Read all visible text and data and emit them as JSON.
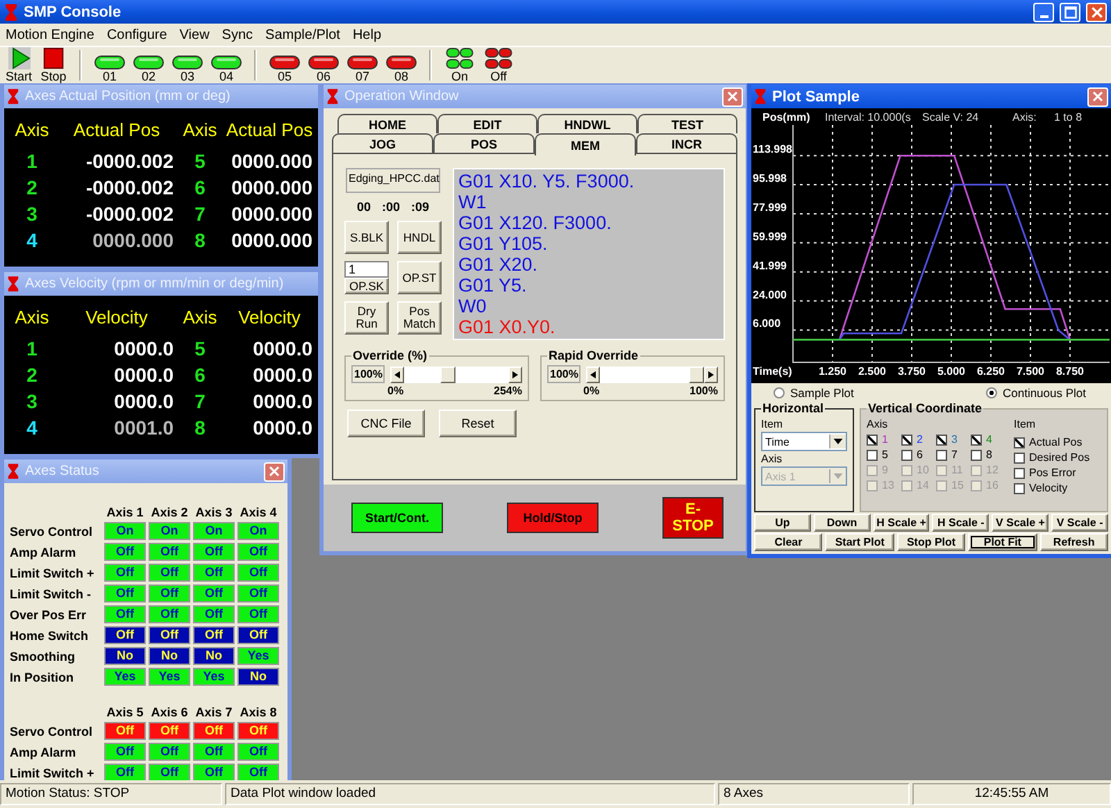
{
  "window": {
    "title": "SMP Console"
  },
  "menu": [
    "Motion Engine",
    "Configure",
    "View",
    "Sync",
    "Sample/Plot",
    "Help"
  ],
  "toolbar": [
    {
      "kind": "start",
      "label": "Start"
    },
    {
      "kind": "stop",
      "label": "Stop"
    },
    {
      "kind": "separator"
    },
    {
      "kind": "led_green",
      "label": "01"
    },
    {
      "kind": "led_green",
      "label": "02"
    },
    {
      "kind": "led_green",
      "label": "03"
    },
    {
      "kind": "led_green",
      "label": "04"
    },
    {
      "kind": "separator"
    },
    {
      "kind": "led_red",
      "label": "05"
    },
    {
      "kind": "led_red",
      "label": "06"
    },
    {
      "kind": "led_red",
      "label": "07"
    },
    {
      "kind": "led_red",
      "label": "08"
    },
    {
      "kind": "separator"
    },
    {
      "kind": "all_on",
      "label": "On"
    },
    {
      "kind": "all_off",
      "label": "Off"
    }
  ],
  "position": {
    "title": "Axes Actual Position (mm or deg)",
    "headers": [
      "Axis",
      "Actual Pos",
      "Axis",
      "Actual Pos"
    ],
    "axes": [
      {
        "label": "1",
        "value": "-0000.002",
        "selected": false
      },
      {
        "label": "2",
        "value": "-0000.002",
        "selected": false
      },
      {
        "label": "3",
        "value": "-0000.002",
        "selected": false
      },
      {
        "label": "4",
        "value": "0000.000",
        "selected": true
      },
      {
        "label": "5",
        "value": "0000.000",
        "selected": false
      },
      {
        "label": "6",
        "value": "0000.000",
        "selected": false
      },
      {
        "label": "7",
        "value": "0000.000",
        "selected": false
      },
      {
        "label": "8",
        "value": "0000.000",
        "selected": false
      }
    ]
  },
  "velocity": {
    "title": "Axes Velocity (rpm or mm/min or deg/min)",
    "headers": [
      "Axis",
      "Velocity",
      "Axis",
      "Velocity"
    ],
    "axes": [
      {
        "label": "1",
        "value": "0000.0",
        "selected": false
      },
      {
        "label": "2",
        "value": "0000.0",
        "selected": false
      },
      {
        "label": "3",
        "value": "0000.0",
        "selected": false
      },
      {
        "label": "4",
        "value": "0001.0",
        "selected": true
      },
      {
        "label": "5",
        "value": "0000.0",
        "selected": false
      },
      {
        "label": "6",
        "value": "0000.0",
        "selected": false
      },
      {
        "label": "7",
        "value": "0000.0",
        "selected": false
      },
      {
        "label": "8",
        "value": "0000.0",
        "selected": false
      }
    ]
  },
  "status": {
    "title": "Axes Status",
    "groups": [
      {
        "columns": [
          "Axis 1",
          "Axis 2",
          "Axis 3",
          "Axis 4"
        ],
        "rows": [
          {
            "label": "Servo Control",
            "cells": [
              {
                "text": "On",
                "kind": "ok"
              },
              {
                "text": "On",
                "kind": "ok"
              },
              {
                "text": "On",
                "kind": "ok"
              },
              {
                "text": "On",
                "kind": "ok"
              }
            ]
          },
          {
            "label": "Amp Alarm",
            "cells": [
              {
                "text": "Off",
                "kind": "ok"
              },
              {
                "text": "Off",
                "kind": "ok"
              },
              {
                "text": "Off",
                "kind": "ok"
              },
              {
                "text": "Off",
                "kind": "ok"
              }
            ]
          },
          {
            "label": "Limit Switch +",
            "cells": [
              {
                "text": "Off",
                "kind": "ok"
              },
              {
                "text": "Off",
                "kind": "ok"
              },
              {
                "text": "Off",
                "kind": "ok"
              },
              {
                "text": "Off",
                "kind": "ok"
              }
            ]
          },
          {
            "label": "Limit Switch -",
            "cells": [
              {
                "text": "Off",
                "kind": "ok"
              },
              {
                "text": "Off",
                "kind": "ok"
              },
              {
                "text": "Off",
                "kind": "ok"
              },
              {
                "text": "Off",
                "kind": "ok"
              }
            ]
          },
          {
            "label": "Over Pos Err",
            "cells": [
              {
                "text": "Off",
                "kind": "ok"
              },
              {
                "text": "Off",
                "kind": "ok"
              },
              {
                "text": "Off",
                "kind": "ok"
              },
              {
                "text": "Off",
                "kind": "ok"
              }
            ]
          },
          {
            "label": "Home Switch",
            "cells": [
              {
                "text": "Off",
                "kind": "info"
              },
              {
                "text": "Off",
                "kind": "info"
              },
              {
                "text": "Off",
                "kind": "info"
              },
              {
                "text": "Off",
                "kind": "info"
              }
            ]
          },
          {
            "label": "Smoothing",
            "cells": [
              {
                "text": "No",
                "kind": "info"
              },
              {
                "text": "No",
                "kind": "info"
              },
              {
                "text": "No",
                "kind": "info"
              },
              {
                "text": "Yes",
                "kind": "ok"
              }
            ]
          },
          {
            "label": "In Position",
            "cells": [
              {
                "text": "Yes",
                "kind": "ok"
              },
              {
                "text": "Yes",
                "kind": "ok"
              },
              {
                "text": "Yes",
                "kind": "ok"
              },
              {
                "text": "No",
                "kind": "info"
              }
            ]
          }
        ]
      },
      {
        "columns": [
          "Axis 5",
          "Axis 6",
          "Axis 7",
          "Axis 8"
        ],
        "rows": [
          {
            "label": "Servo Control",
            "cells": [
              {
                "text": "Off",
                "kind": "alarm"
              },
              {
                "text": "Off",
                "kind": "alarm"
              },
              {
                "text": "Off",
                "kind": "alarm"
              },
              {
                "text": "Off",
                "kind": "alarm"
              }
            ]
          },
          {
            "label": "Amp Alarm",
            "cells": [
              {
                "text": "Off",
                "kind": "ok"
              },
              {
                "text": "Off",
                "kind": "ok"
              },
              {
                "text": "Off",
                "kind": "ok"
              },
              {
                "text": "Off",
                "kind": "ok"
              }
            ]
          },
          {
            "label": "Limit Switch +",
            "cells": [
              {
                "text": "Off",
                "kind": "ok"
              },
              {
                "text": "Off",
                "kind": "ok"
              },
              {
                "text": "Off",
                "kind": "ok"
              },
              {
                "text": "Off",
                "kind": "ok"
              }
            ]
          }
        ]
      }
    ]
  },
  "operation": {
    "title": "Operation Window",
    "tab_rows": [
      [
        {
          "label": "HOME",
          "selected": false
        },
        {
          "label": "EDIT",
          "selected": false
        },
        {
          "label": "HNDWL",
          "selected": false
        },
        {
          "label": "TEST",
          "selected": false
        }
      ],
      [
        {
          "label": "JOG",
          "selected": false
        },
        {
          "label": "POS",
          "selected": false
        },
        {
          "label": "MEM",
          "selected": true
        },
        {
          "label": "INCR",
          "selected": false
        }
      ]
    ],
    "file_name": "Edging_HPCC.dat",
    "timer": [
      "00",
      ":00",
      ":09"
    ],
    "controls": [
      {
        "kind": "button",
        "label": "S.BLK"
      },
      {
        "kind": "button",
        "label": "HNDL"
      },
      {
        "kind": "skip",
        "value": "1",
        "label": "OP.SK"
      },
      {
        "kind": "button",
        "label": "OP.ST"
      },
      {
        "kind": "button",
        "label": "Dry Run"
      },
      {
        "kind": "button",
        "label": "Pos Match"
      }
    ],
    "program": [
      {
        "text": "G01 X10. Y5. F3000.",
        "current": false
      },
      {
        "text": "W1",
        "current": false
      },
      {
        "text": "G01 X120. F3000.",
        "current": false
      },
      {
        "text": "G01 Y105.",
        "current": false
      },
      {
        "text": "G01 X20.",
        "current": false
      },
      {
        "text": "G01 Y5.",
        "current": false
      },
      {
        "text": "W0",
        "current": false
      },
      {
        "text": "G01 X0.Y0.",
        "current": true
      }
    ],
    "overrides": [
      {
        "title": "Override (%)",
        "value": "100%",
        "min": "0%",
        "max": "254%",
        "level": 0.4
      },
      {
        "title": "Rapid Override",
        "value": "100%",
        "min": "0%",
        "max": "100%",
        "level": 1
      }
    ],
    "buttons": [
      "CNC File",
      "Reset"
    ],
    "actions": [
      {
        "label": "Start/Cont.",
        "kind": "start"
      },
      {
        "label": "Hold/Stop",
        "kind": "hold"
      },
      {
        "label": "E-STOP",
        "kind": "estop"
      }
    ]
  },
  "plot": {
    "title": "Plot Sample",
    "header": [
      "Interval: 10.000(s",
      "Scale V: 24",
      "Axis:",
      "1 to 8"
    ],
    "chart_data": {
      "type": "line",
      "xlabel": "Time(s)",
      "ylabel": "Pos(mm)",
      "x": [
        0,
        1.47,
        1.6,
        3.39,
        3.42,
        5.09,
        6.7,
        6.74,
        8.38,
        8.44,
        8.75,
        10
      ],
      "series": [
        {
          "color": "#c050d0",
          "values": [
            null,
            0,
            8,
            114,
            114,
            114,
            19,
            19,
            19,
            19,
            0,
            null
          ]
        },
        {
          "color": "#5050e0",
          "values": [
            null,
            0,
            4,
            4,
            4,
            96,
            96,
            96,
            6,
            5,
            0,
            null
          ]
        },
        {
          "color": "#40c040",
          "values": [
            0,
            0,
            0,
            0,
            0,
            0,
            0,
            0,
            0,
            0,
            0,
            0
          ]
        }
      ],
      "xlim": [
        0,
        10
      ],
      "ylim": [
        -14,
        133
      ],
      "grid": true,
      "xticks": [
        {
          "value": 1.25,
          "label": "1.250"
        },
        {
          "value": 2.5,
          "label": "2.500"
        },
        {
          "value": 3.75,
          "label": "3.750"
        },
        {
          "value": 5,
          "label": "5.000"
        },
        {
          "value": 6.25,
          "label": "6.250"
        },
        {
          "value": 7.5,
          "label": "7.500"
        },
        {
          "value": 8.75,
          "label": "8.750"
        }
      ],
      "yticks": [
        {
          "value": 6,
          "label": "6.000"
        },
        {
          "value": 24,
          "label": "24.000"
        },
        {
          "value": 41.999,
          "label": "41.999"
        },
        {
          "value": 59.999,
          "label": "59.999"
        },
        {
          "value": 77.999,
          "label": "77.999"
        },
        {
          "value": 95.998,
          "label": "95.998"
        },
        {
          "value": 113.998,
          "label": "113.998"
        }
      ]
    },
    "modes": [
      {
        "label": "Sample Plot",
        "selected": false
      },
      {
        "label": "Continuous Plot",
        "selected": true
      }
    ],
    "horizontal": {
      "title": "Horizontal",
      "item_label": "Item",
      "item_value": "Time",
      "axis_label": "Axis",
      "axis_value": "Axis 1",
      "axis_disabled": true
    },
    "vertical": {
      "title": "Vertical Coordinate",
      "axis_header": "Axis",
      "item_header": "Item",
      "axes": [
        {
          "label": "1",
          "checked": true,
          "disabled": false,
          "color": "#b030c0"
        },
        {
          "label": "2",
          "checked": true,
          "disabled": false,
          "color": "#2040f0"
        },
        {
          "label": "3",
          "checked": true,
          "disabled": false,
          "color": "#2070b0"
        },
        {
          "label": "4",
          "checked": true,
          "disabled": false,
          "color": "#108a10"
        },
        {
          "label": "5",
          "checked": false,
          "disabled": false
        },
        {
          "label": "6",
          "checked": false,
          "disabled": false
        },
        {
          "label": "7",
          "checked": false,
          "disabled": false
        },
        {
          "label": "8",
          "checked": false,
          "disabled": false
        },
        {
          "label": "9",
          "checked": false,
          "disabled": true
        },
        {
          "label": "10",
          "checked": false,
          "disabled": true
        },
        {
          "label": "11",
          "checked": false,
          "disabled": true
        },
        {
          "label": "12",
          "checked": false,
          "disabled": true
        },
        {
          "label": "13",
          "checked": false,
          "disabled": true
        },
        {
          "label": "14",
          "checked": false,
          "disabled": true
        },
        {
          "label": "15",
          "checked": false,
          "disabled": true
        },
        {
          "label": "16",
          "checked": false,
          "disabled": true
        }
      ],
      "items": [
        {
          "label": "Actual Pos",
          "checked": true
        },
        {
          "label": "Desired Pos",
          "checked": false
        },
        {
          "label": "Pos Error",
          "checked": false
        },
        {
          "label": "Velocity",
          "checked": false
        }
      ]
    },
    "button_rows": [
      [
        {
          "label": "Up",
          "focused": false
        },
        {
          "label": "Down",
          "focused": false
        },
        {
          "label": "H Scale +",
          "focused": false
        },
        {
          "label": "H Scale -",
          "focused": false
        },
        {
          "label": "V Scale +",
          "focused": false
        },
        {
          "label": "V Scale -",
          "focused": false
        }
      ],
      [
        {
          "label": "Clear",
          "focused": false
        },
        {
          "label": "Start Plot",
          "focused": false
        },
        {
          "label": "Stop Plot",
          "focused": false
        },
        {
          "label": "Plot Fit",
          "focused": true
        },
        {
          "label": "Refresh",
          "focused": false
        }
      ]
    ]
  },
  "status_bar": [
    "Motion Status: STOP",
    "Data Plot window loaded",
    "8 Axes",
    "12:45:55 AM"
  ]
}
